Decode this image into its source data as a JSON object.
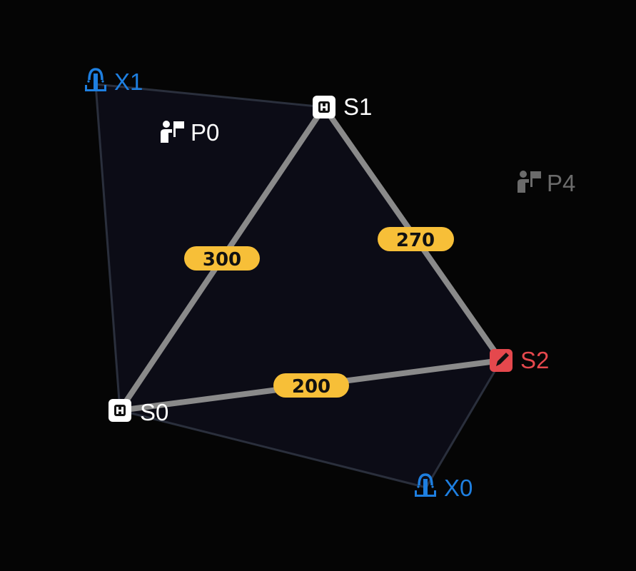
{
  "colors": {
    "background": "#050505",
    "region_fill": "#0c0c16",
    "region_stroke": "#2a2f3c",
    "edge": "#8a8a8a",
    "pill": "#f7bf38",
    "white_node": "#ffffff",
    "blue_node": "#1e7fe0",
    "red_node": "#e5484d",
    "dim_node": "#6b6b6b"
  },
  "nodes": {
    "x1": {
      "label": "X1",
      "icon": "fountain-icon",
      "style": "blue"
    },
    "s1": {
      "label": "S1",
      "icon": "station-icon",
      "style": "white"
    },
    "p0": {
      "label": "P0",
      "icon": "person-sign-icon",
      "style": "white"
    },
    "p4": {
      "label": "P4",
      "icon": "person-sign-icon",
      "style": "dim"
    },
    "s2": {
      "label": "S2",
      "icon": "pencil-icon",
      "style": "red"
    },
    "s0": {
      "label": "S0",
      "icon": "station-icon",
      "style": "white"
    },
    "x0": {
      "label": "X0",
      "icon": "fountain-icon",
      "style": "blue"
    }
  },
  "edges": {
    "s0_s1": {
      "from": "S0",
      "to": "S1",
      "weight": "300"
    },
    "s1_s2": {
      "from": "S1",
      "to": "S2",
      "weight": "270"
    },
    "s0_s2": {
      "from": "S0",
      "to": "S2",
      "weight": "200"
    }
  }
}
